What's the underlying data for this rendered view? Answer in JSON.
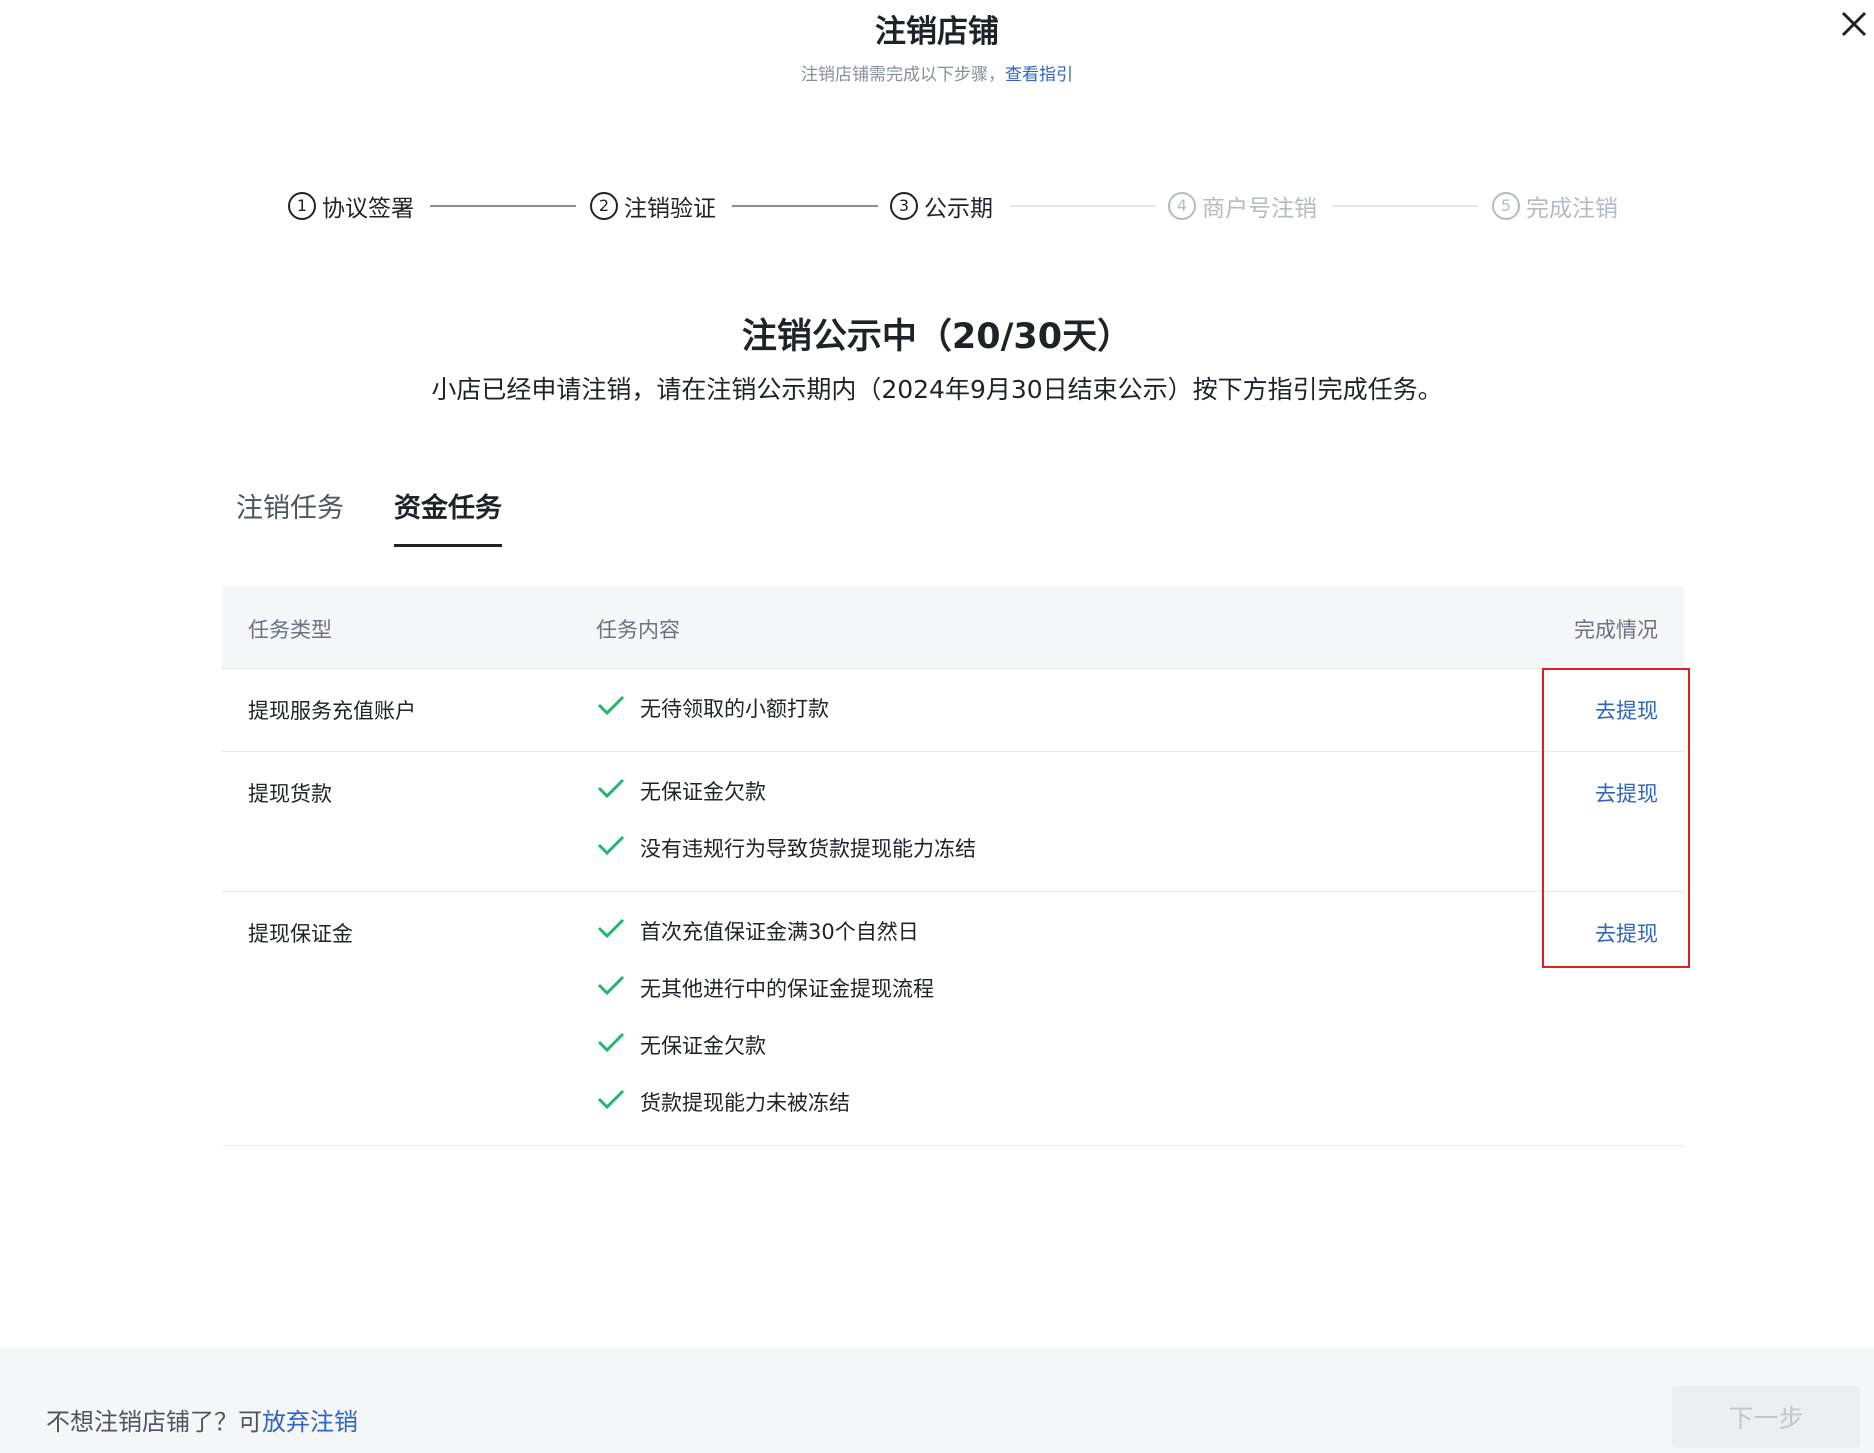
{
  "header": {
    "title": "注销店铺",
    "subtitle": "注销店铺需完成以下步骤，",
    "guide_link": "查看指引"
  },
  "steps": [
    {
      "num": "1",
      "label": "协议签署",
      "state": "done"
    },
    {
      "num": "2",
      "label": "注销验证",
      "state": "done"
    },
    {
      "num": "3",
      "label": "公示期",
      "state": "current"
    },
    {
      "num": "4",
      "label": "商户号注销",
      "state": "todo"
    },
    {
      "num": "5",
      "label": "完成注销",
      "state": "todo"
    }
  ],
  "status": {
    "title": "注销公示中（20/30天）",
    "description": "小店已经申请注销，请在注销公示期内（2024年9月30日结束公示）按下方指引完成任务。"
  },
  "tabs": [
    {
      "label": "注销任务",
      "active": false
    },
    {
      "label": "资金任务",
      "active": true
    }
  ],
  "table": {
    "headers": {
      "type": "任务类型",
      "content": "任务内容",
      "status": "完成情况"
    },
    "rows": [
      {
        "type": "提现服务充值账户",
        "items": [
          "无待领取的小额打款"
        ],
        "action": "去提现"
      },
      {
        "type": "提现货款",
        "items": [
          "无保证金欠款",
          "没有违规行为导致货款提现能力冻结"
        ],
        "action": "去提现"
      },
      {
        "type": "提现保证金",
        "items": [
          "首次充值保证金满30个自然日",
          "无其他进行中的保证金提现流程",
          "无保证金欠款",
          "货款提现能力未被冻结"
        ],
        "action": "去提现"
      }
    ]
  },
  "footer": {
    "prompt": "不想注销店铺了？可",
    "cancel_link": "放弃注销",
    "next_button": "下一步"
  },
  "colors": {
    "link": "#2f64c2",
    "check": "#22b573",
    "highlight": "#e02020"
  }
}
